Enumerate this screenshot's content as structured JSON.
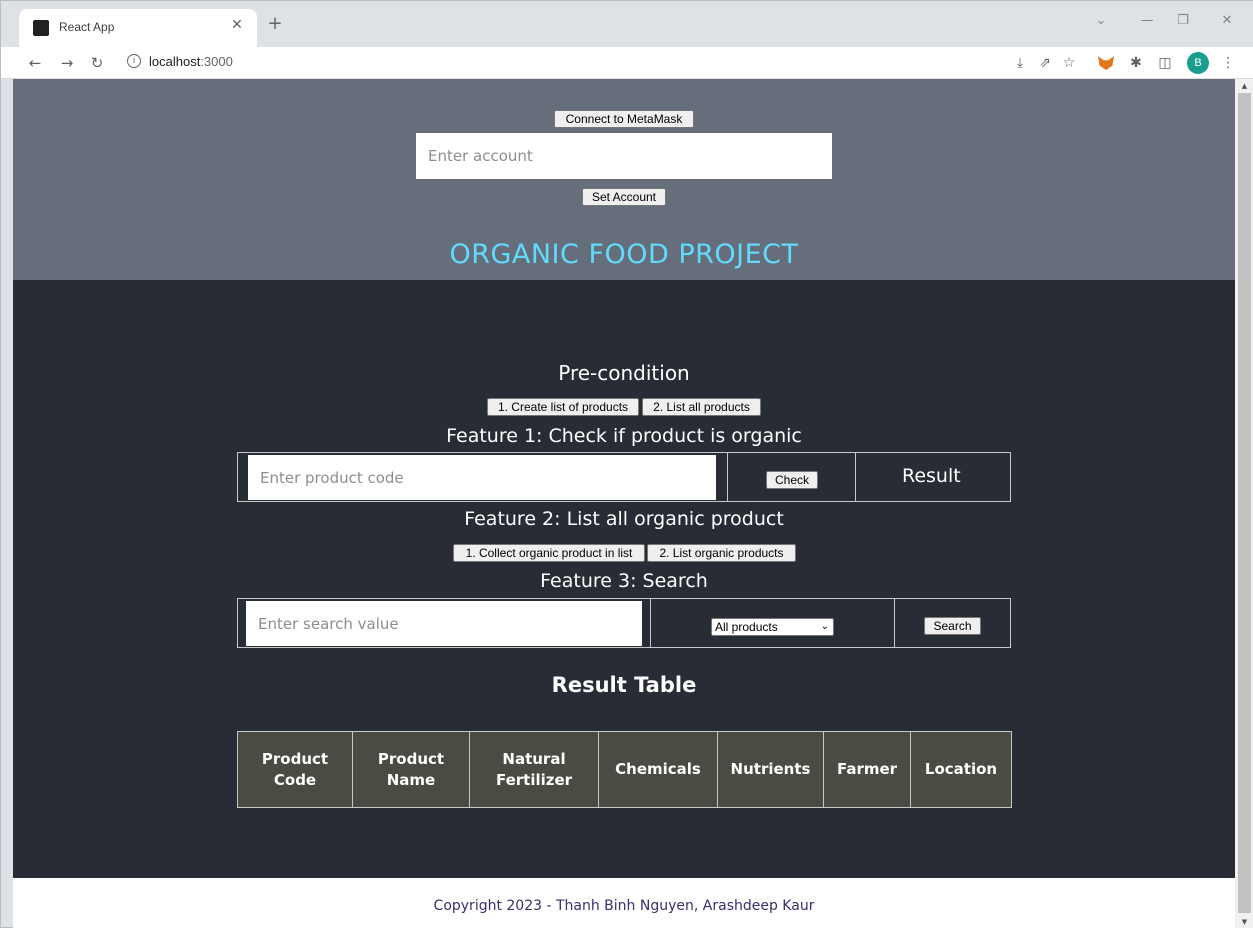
{
  "browser": {
    "tab_title": "React App",
    "url_host": "localhost",
    "url_port": ":3000",
    "profile_initial": "B"
  },
  "header": {
    "connect_button": "Connect to MetaMask",
    "account_placeholder": "Enter account",
    "set_account_button": "Set Account",
    "title": "ORGANIC FOOD PROJECT"
  },
  "precondition": {
    "heading": "Pre-condition",
    "create_button": "1. Create list of products",
    "list_button": "2. List all products"
  },
  "feature1": {
    "heading": "Feature 1: Check if product is organic",
    "input_placeholder": "Enter product code",
    "check_button": "Check",
    "result_label": "Result"
  },
  "feature2": {
    "heading": "Feature 2: List all organic product",
    "collect_button": "1. Collect organic product in list",
    "list_button": "2. List organic products"
  },
  "feature3": {
    "heading": "Feature 3: Search",
    "input_placeholder": "Enter search value",
    "filter_selected": "All products",
    "search_button": "Search"
  },
  "result_table": {
    "heading": "Result Table",
    "columns": [
      [
        "Product",
        "Code"
      ],
      [
        "Product",
        "Name"
      ],
      [
        "Natural",
        "Fertilizer"
      ],
      [
        "Chemicals"
      ],
      [
        "Nutrients"
      ],
      [
        "Farmer"
      ],
      [
        "Location"
      ]
    ]
  },
  "footer": {
    "copyright": "Copyright 2023 - Thanh Binh Nguyen, Arashdeep Kaur"
  },
  "colors": {
    "header_bg": "#666d7b",
    "body_bg": "#282c34",
    "title_accent": "#61dafb",
    "table_header_bg": "#4a4b42",
    "footer_text": "#37306b"
  }
}
